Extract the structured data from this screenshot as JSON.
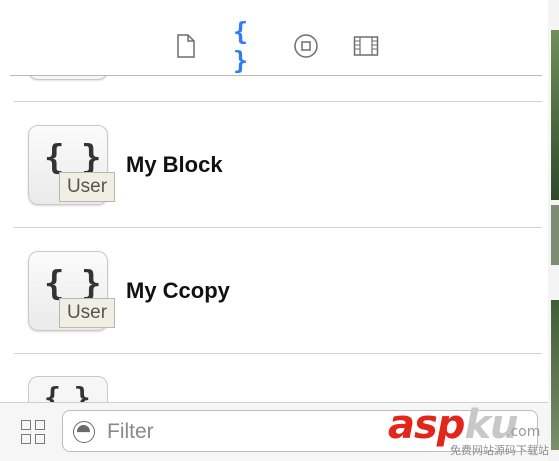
{
  "toolbar": {
    "tabs": [
      {
        "icon": "file-icon",
        "active": false
      },
      {
        "icon": "braces-icon",
        "glyph": "{ }",
        "active": true
      },
      {
        "icon": "object-icon",
        "active": false
      },
      {
        "icon": "media-icon",
        "active": false
      }
    ],
    "accent_color": "#2e7cf6"
  },
  "library": {
    "items": [
      {
        "title": "My Block",
        "icon": "code-snippet-icon",
        "glyph": "{ }",
        "badge": "User"
      },
      {
        "title": "My Ccopy",
        "icon": "code-snippet-icon",
        "glyph": "{ }",
        "badge": "User"
      }
    ],
    "partial_glyph": "{ }"
  },
  "bottom_bar": {
    "grid_icon": "grid-view-icon",
    "filter": {
      "placeholder": "Filter",
      "value": "",
      "icon": "filter-icon"
    }
  },
  "watermark": {
    "main_asp": "asp",
    "main_ku": "ku",
    "suffix": ".com",
    "caption": "免费网站源码下载站"
  }
}
